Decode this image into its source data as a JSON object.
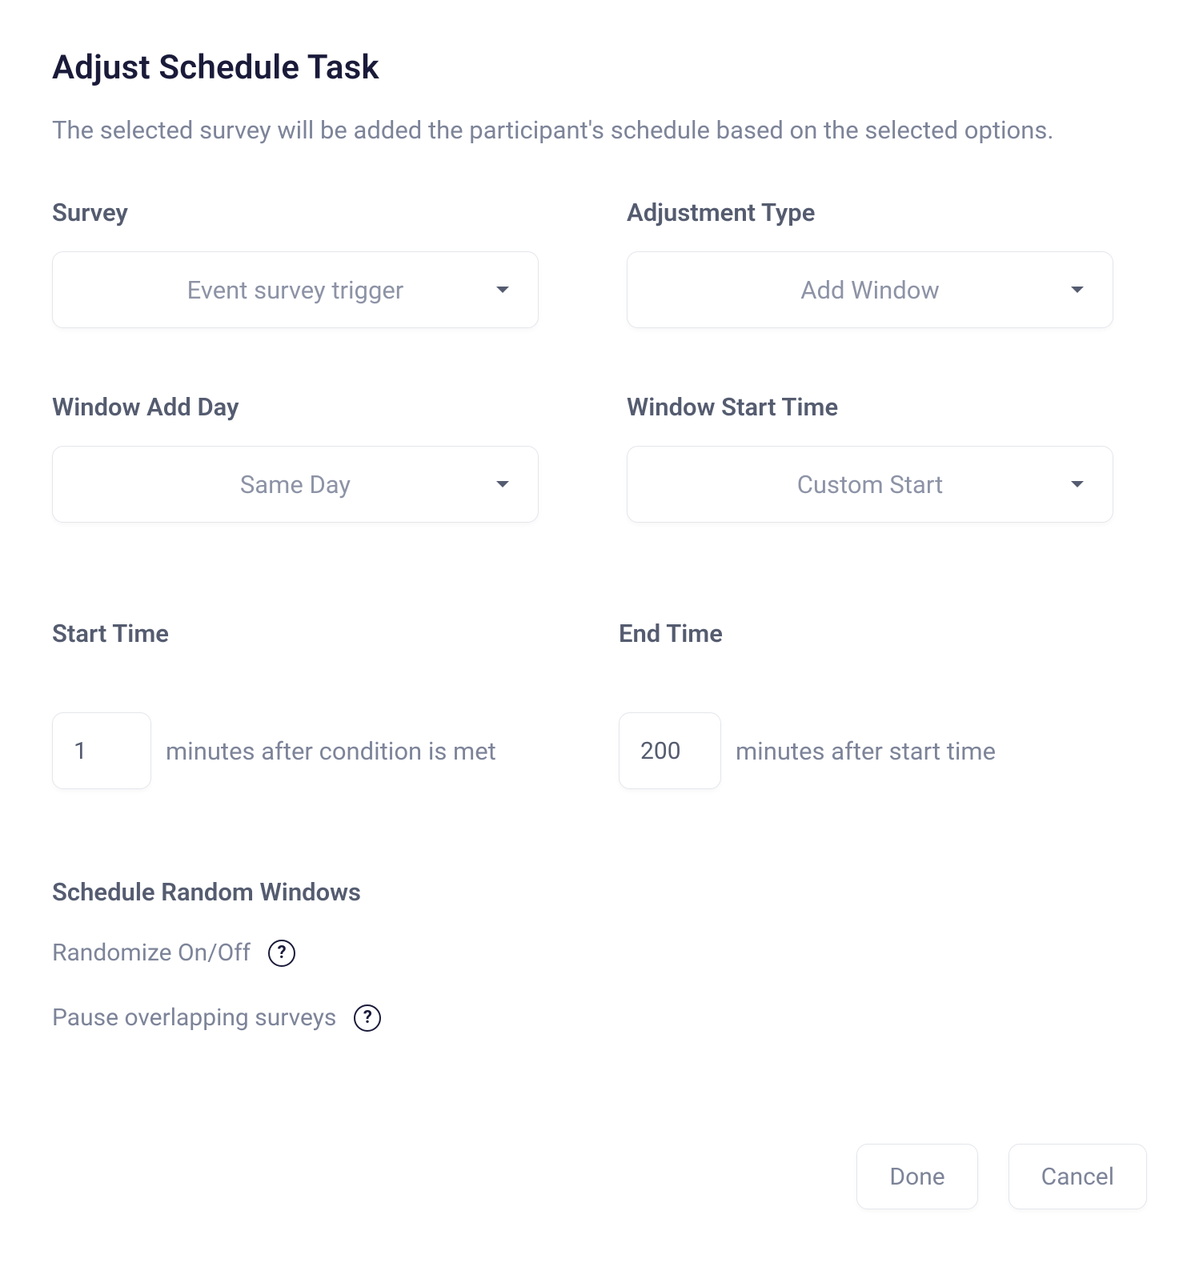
{
  "header": {
    "title": "Adjust Schedule Task",
    "subtitle": "The selected survey will be added the participant's schedule based on the selected options."
  },
  "fields": {
    "survey": {
      "label": "Survey",
      "value": "Event survey trigger"
    },
    "adjustment_type": {
      "label": "Adjustment Type",
      "value": "Add Window"
    },
    "window_add_day": {
      "label": "Window Add Day",
      "value": "Same Day"
    },
    "window_start_time": {
      "label": "Window Start Time",
      "value": "Custom Start"
    }
  },
  "time": {
    "start": {
      "label": "Start Time",
      "value": "1",
      "suffix": "minutes after condition is met"
    },
    "end": {
      "label": "End Time",
      "value": "200",
      "suffix": "minutes after start time"
    }
  },
  "random": {
    "heading": "Schedule Random Windows",
    "randomize": {
      "label": "Randomize On/Off",
      "on": false
    },
    "pause_overlap": {
      "label": "Pause overlapping surveys",
      "on": true
    }
  },
  "footer": {
    "done": "Done",
    "cancel": "Cancel"
  },
  "help_glyph": "?"
}
